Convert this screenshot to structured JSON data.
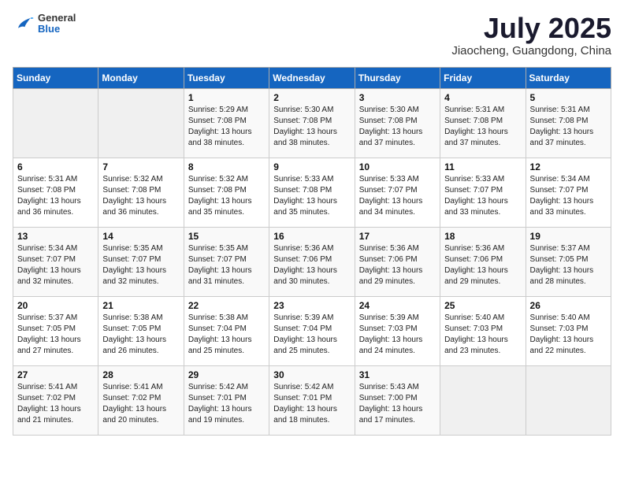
{
  "header": {
    "logo_general": "General",
    "logo_blue": "Blue",
    "month_title": "July 2025",
    "location": "Jiaocheng, Guangdong, China"
  },
  "days_of_week": [
    "Sunday",
    "Monday",
    "Tuesday",
    "Wednesday",
    "Thursday",
    "Friday",
    "Saturday"
  ],
  "weeks": [
    [
      {
        "day": "",
        "info": ""
      },
      {
        "day": "",
        "info": ""
      },
      {
        "day": "1",
        "info": "Sunrise: 5:29 AM\nSunset: 7:08 PM\nDaylight: 13 hours and 38 minutes."
      },
      {
        "day": "2",
        "info": "Sunrise: 5:30 AM\nSunset: 7:08 PM\nDaylight: 13 hours and 38 minutes."
      },
      {
        "day": "3",
        "info": "Sunrise: 5:30 AM\nSunset: 7:08 PM\nDaylight: 13 hours and 37 minutes."
      },
      {
        "day": "4",
        "info": "Sunrise: 5:31 AM\nSunset: 7:08 PM\nDaylight: 13 hours and 37 minutes."
      },
      {
        "day": "5",
        "info": "Sunrise: 5:31 AM\nSunset: 7:08 PM\nDaylight: 13 hours and 37 minutes."
      }
    ],
    [
      {
        "day": "6",
        "info": "Sunrise: 5:31 AM\nSunset: 7:08 PM\nDaylight: 13 hours and 36 minutes."
      },
      {
        "day": "7",
        "info": "Sunrise: 5:32 AM\nSunset: 7:08 PM\nDaylight: 13 hours and 36 minutes."
      },
      {
        "day": "8",
        "info": "Sunrise: 5:32 AM\nSunset: 7:08 PM\nDaylight: 13 hours and 35 minutes."
      },
      {
        "day": "9",
        "info": "Sunrise: 5:33 AM\nSunset: 7:08 PM\nDaylight: 13 hours and 35 minutes."
      },
      {
        "day": "10",
        "info": "Sunrise: 5:33 AM\nSunset: 7:07 PM\nDaylight: 13 hours and 34 minutes."
      },
      {
        "day": "11",
        "info": "Sunrise: 5:33 AM\nSunset: 7:07 PM\nDaylight: 13 hours and 33 minutes."
      },
      {
        "day": "12",
        "info": "Sunrise: 5:34 AM\nSunset: 7:07 PM\nDaylight: 13 hours and 33 minutes."
      }
    ],
    [
      {
        "day": "13",
        "info": "Sunrise: 5:34 AM\nSunset: 7:07 PM\nDaylight: 13 hours and 32 minutes."
      },
      {
        "day": "14",
        "info": "Sunrise: 5:35 AM\nSunset: 7:07 PM\nDaylight: 13 hours and 32 minutes."
      },
      {
        "day": "15",
        "info": "Sunrise: 5:35 AM\nSunset: 7:07 PM\nDaylight: 13 hours and 31 minutes."
      },
      {
        "day": "16",
        "info": "Sunrise: 5:36 AM\nSunset: 7:06 PM\nDaylight: 13 hours and 30 minutes."
      },
      {
        "day": "17",
        "info": "Sunrise: 5:36 AM\nSunset: 7:06 PM\nDaylight: 13 hours and 29 minutes."
      },
      {
        "day": "18",
        "info": "Sunrise: 5:36 AM\nSunset: 7:06 PM\nDaylight: 13 hours and 29 minutes."
      },
      {
        "day": "19",
        "info": "Sunrise: 5:37 AM\nSunset: 7:05 PM\nDaylight: 13 hours and 28 minutes."
      }
    ],
    [
      {
        "day": "20",
        "info": "Sunrise: 5:37 AM\nSunset: 7:05 PM\nDaylight: 13 hours and 27 minutes."
      },
      {
        "day": "21",
        "info": "Sunrise: 5:38 AM\nSunset: 7:05 PM\nDaylight: 13 hours and 26 minutes."
      },
      {
        "day": "22",
        "info": "Sunrise: 5:38 AM\nSunset: 7:04 PM\nDaylight: 13 hours and 25 minutes."
      },
      {
        "day": "23",
        "info": "Sunrise: 5:39 AM\nSunset: 7:04 PM\nDaylight: 13 hours and 25 minutes."
      },
      {
        "day": "24",
        "info": "Sunrise: 5:39 AM\nSunset: 7:03 PM\nDaylight: 13 hours and 24 minutes."
      },
      {
        "day": "25",
        "info": "Sunrise: 5:40 AM\nSunset: 7:03 PM\nDaylight: 13 hours and 23 minutes."
      },
      {
        "day": "26",
        "info": "Sunrise: 5:40 AM\nSunset: 7:03 PM\nDaylight: 13 hours and 22 minutes."
      }
    ],
    [
      {
        "day": "27",
        "info": "Sunrise: 5:41 AM\nSunset: 7:02 PM\nDaylight: 13 hours and 21 minutes."
      },
      {
        "day": "28",
        "info": "Sunrise: 5:41 AM\nSunset: 7:02 PM\nDaylight: 13 hours and 20 minutes."
      },
      {
        "day": "29",
        "info": "Sunrise: 5:42 AM\nSunset: 7:01 PM\nDaylight: 13 hours and 19 minutes."
      },
      {
        "day": "30",
        "info": "Sunrise: 5:42 AM\nSunset: 7:01 PM\nDaylight: 13 hours and 18 minutes."
      },
      {
        "day": "31",
        "info": "Sunrise: 5:43 AM\nSunset: 7:00 PM\nDaylight: 13 hours and 17 minutes."
      },
      {
        "day": "",
        "info": ""
      },
      {
        "day": "",
        "info": ""
      }
    ]
  ]
}
